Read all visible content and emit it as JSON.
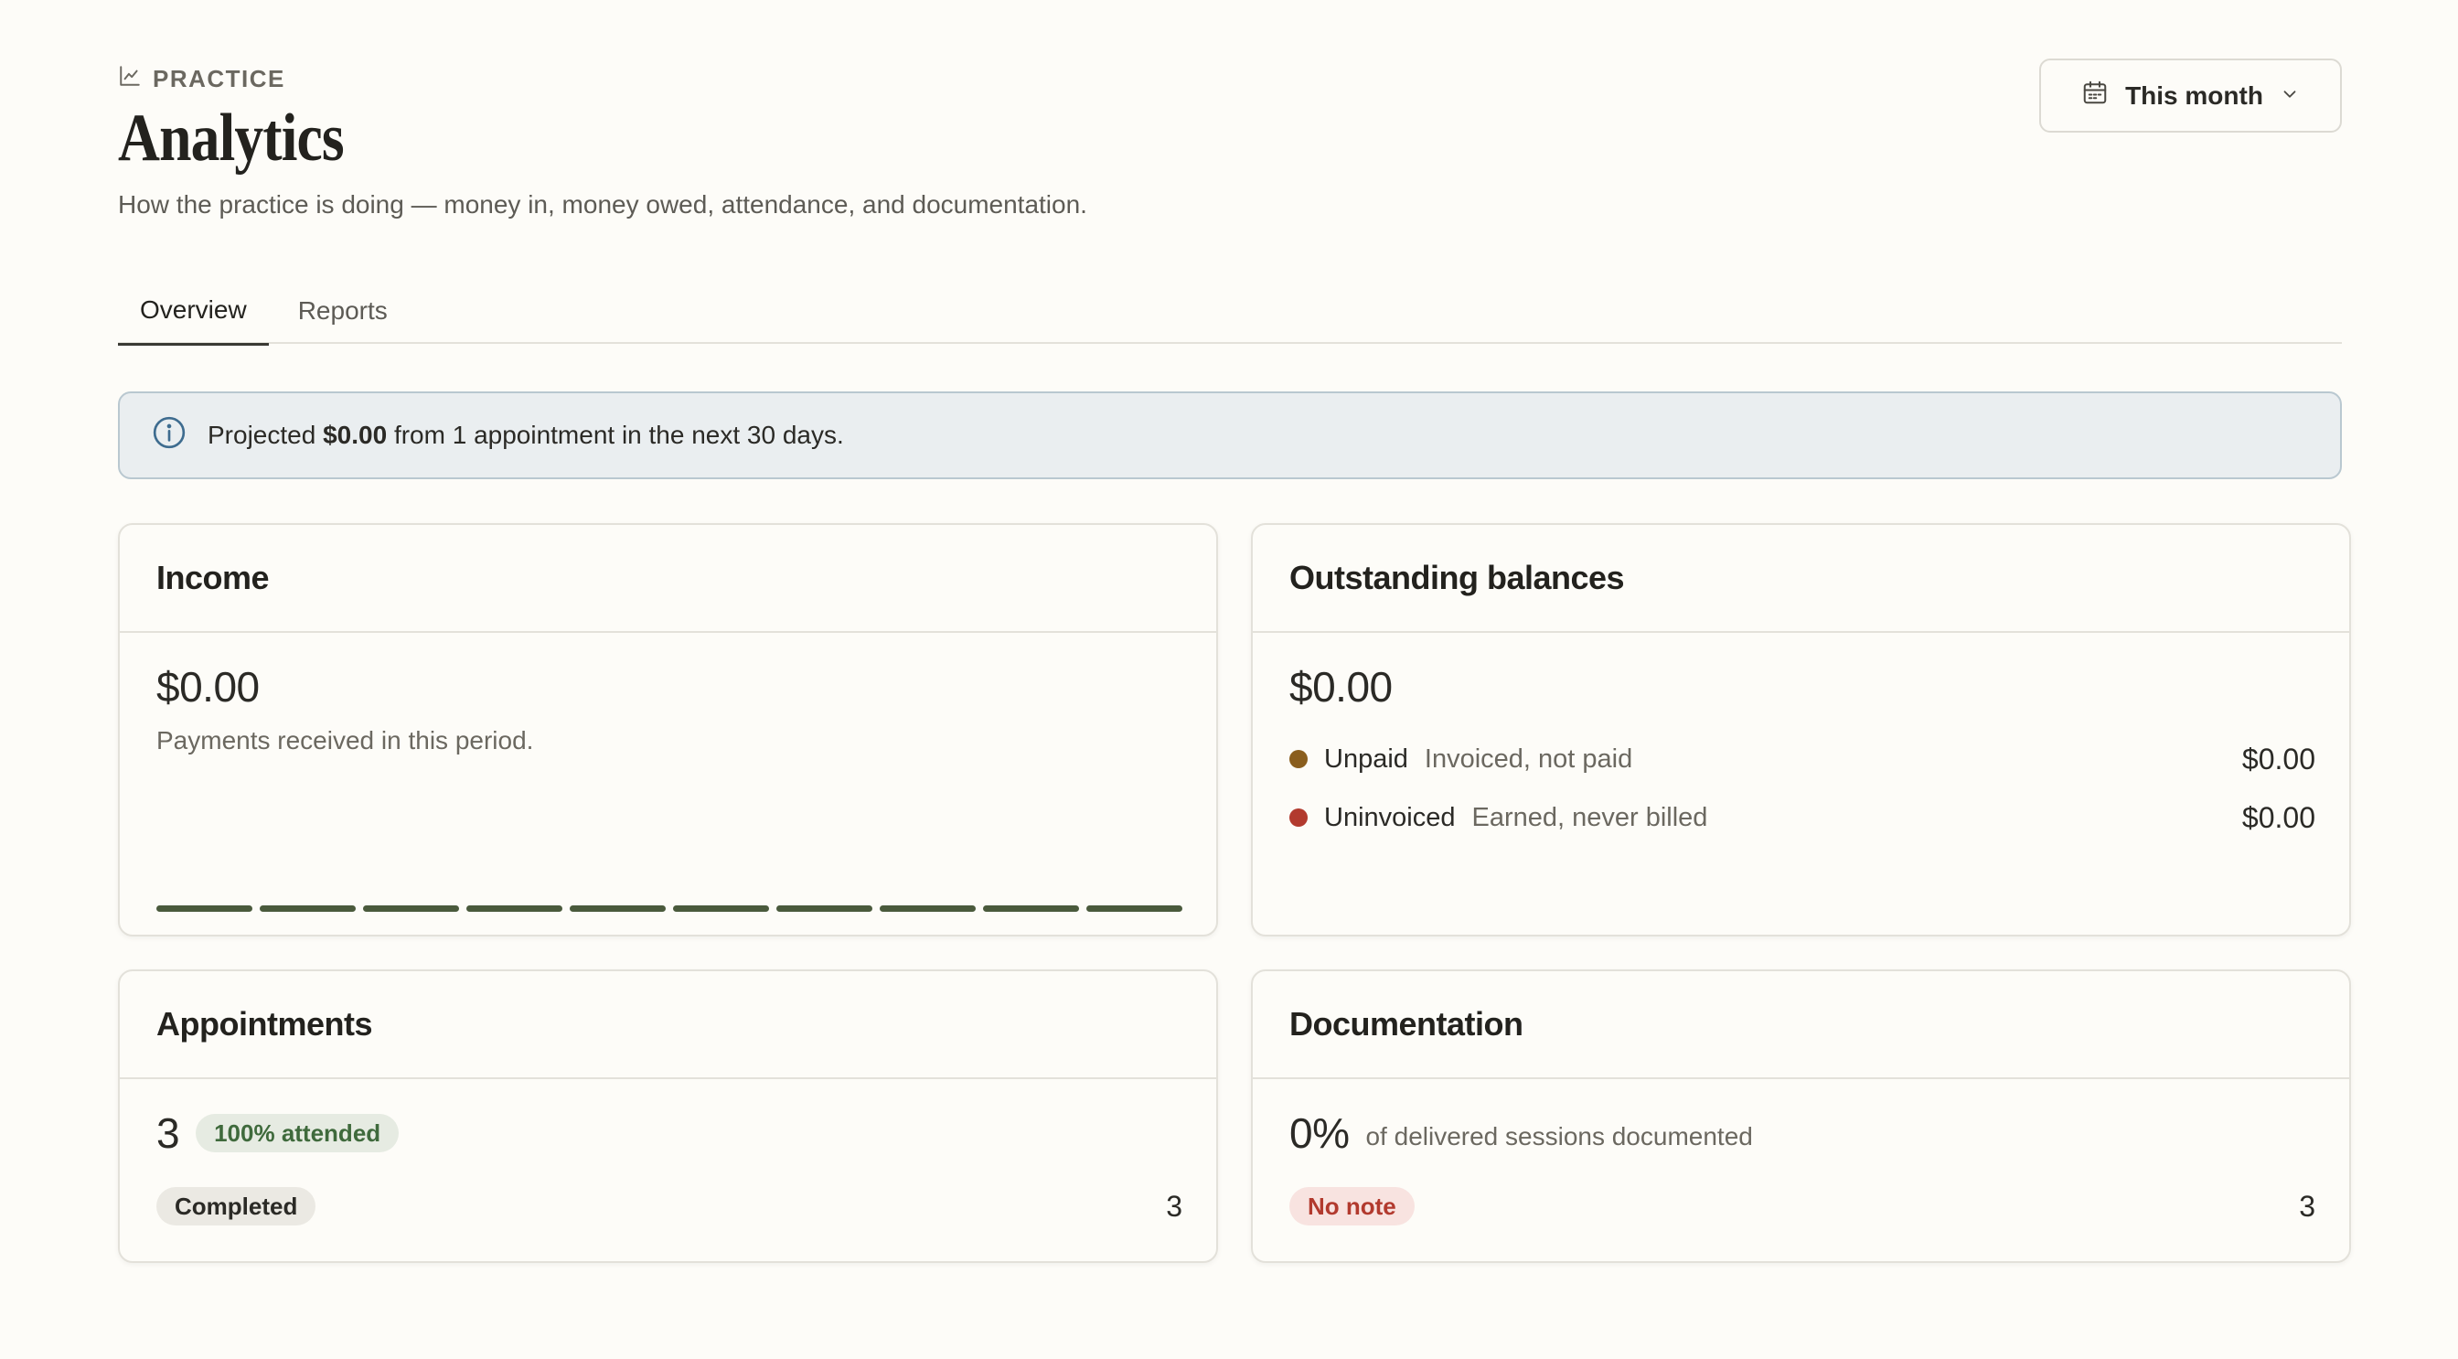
{
  "header": {
    "eyebrow": "PRACTICE",
    "title": "Analytics",
    "subtitle": "How the practice is doing — money in, money owed, attendance, and documentation.",
    "period_label": "This month"
  },
  "tabs": [
    {
      "label": "Overview",
      "active": true
    },
    {
      "label": "Reports",
      "active": false
    }
  ],
  "banner": {
    "prefix": "Projected",
    "amount": "$0.00",
    "suffix": "from 1 appointment in the next 30 days."
  },
  "income": {
    "title": "Income",
    "value": "$0.00",
    "description": "Payments received in this period."
  },
  "outstanding": {
    "title": "Outstanding balances",
    "value": "$0.00",
    "rows": [
      {
        "label": "Unpaid",
        "sub": "Invoiced, not paid",
        "amount": "$0.00",
        "color": "#8a5e1e"
      },
      {
        "label": "Uninvoiced",
        "sub": "Earned, never billed",
        "amount": "$0.00",
        "color": "#b23a2e"
      }
    ]
  },
  "appointments": {
    "title": "Appointments",
    "count": "3",
    "attended_badge": "100% attended",
    "status_label": "Completed",
    "status_count": "3"
  },
  "documentation": {
    "title": "Documentation",
    "percent": "0%",
    "percent_caption": "of delivered sessions documented",
    "status_label": "No note",
    "status_count": "3"
  },
  "colors": {
    "accent_dark": "#4a5a3c",
    "info_bg": "#eaeef0",
    "info_border": "#b9c8d0"
  }
}
